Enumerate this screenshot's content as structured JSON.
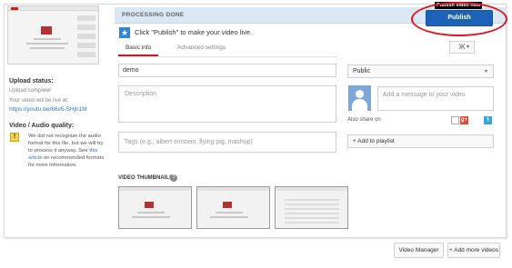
{
  "left": {
    "upload_status_title": "Upload status:",
    "upload_complete": "Upload complete!",
    "live_text": "Your video will be live at:",
    "live_link": "https://youtu.be/66v5-SHjh1M",
    "quality_title": "Video / Audio quality:",
    "warning_text": "We did not recognize the audio format for this file, but we will try to process it anyway. See",
    "warning_link": "this article",
    "warning_text_end": "on recommended formats for more information."
  },
  "banner": {
    "title": "PROCESSING DONE",
    "annotation_label": "Publish video now",
    "publish_label": "Publish"
  },
  "info": {
    "text": "Click \"Publish\" to make your video live."
  },
  "tabs": [
    {
      "label": "Basic info",
      "active": true
    },
    {
      "label": "Advanced settings",
      "active": false
    }
  ],
  "form": {
    "title_value": "demo",
    "description_placeholder": "Description",
    "tags_placeholder": "Tags (e.g., albert einstein, flying pig, mashup)",
    "privacy_value": "Public",
    "message_placeholder": "Add a message to your video",
    "share_label": "Also share on",
    "playlist_label": "+ Add to playlist"
  },
  "thumbnails": {
    "title": "VIDEO THUMBNAILS"
  },
  "footer": {
    "video_manager": "Video Manager",
    "add_more": "+ Add more videos"
  },
  "icons": {
    "info": "star-icon",
    "warning": "warning-icon",
    "help": "help-icon",
    "translate": "translate-icon",
    "google_plus": "google-plus-icon",
    "twitter": "twitter-icon"
  },
  "colors": {
    "publish_button": "#1c62b9",
    "banner_bg": "#dbe7f2",
    "annotation_ellipse": "#e0141c",
    "active_tab_underline": "#cc181e"
  }
}
